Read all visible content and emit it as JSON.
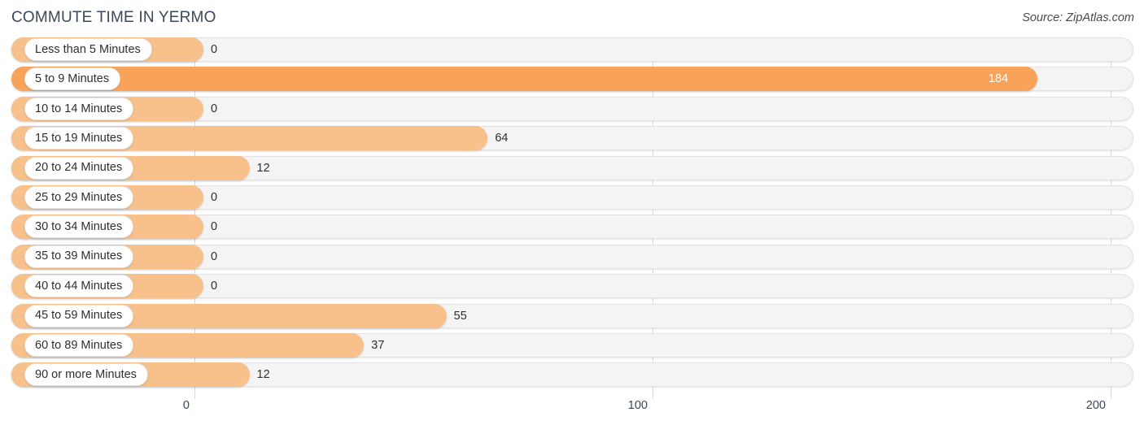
{
  "header": {
    "title": "COMMUTE TIME IN YERMO",
    "source": "Source: ZipAtlas.com"
  },
  "colors": {
    "bar": "#f8c08a",
    "bar_highlight": "#f9a35a",
    "track": "#f4f4f4",
    "gridline": "#d9d9d9",
    "text": "#2f2f2f",
    "title": "#3c4858"
  },
  "chart_data": {
    "type": "bar",
    "orientation": "horizontal",
    "title": "COMMUTE TIME IN YERMO",
    "subtitle": "",
    "xlabel": "",
    "ylabel": "",
    "xlim": [
      0,
      200
    ],
    "grid": true,
    "legend": null,
    "source": "Source: ZipAtlas.com",
    "xticks": [
      "0",
      "100",
      "200"
    ],
    "xtick_values": [
      0,
      100,
      200
    ],
    "categories": [
      "Less than 5 Minutes",
      "5 to 9 Minutes",
      "10 to 14 Minutes",
      "15 to 19 Minutes",
      "20 to 24 Minutes",
      "25 to 29 Minutes",
      "30 to 34 Minutes",
      "35 to 39 Minutes",
      "40 to 44 Minutes",
      "45 to 59 Minutes",
      "60 to 89 Minutes",
      "90 or more Minutes"
    ],
    "values": [
      0,
      184,
      0,
      64,
      12,
      0,
      0,
      0,
      0,
      55,
      37,
      12
    ],
    "value_labels": [
      "0",
      "184",
      "0",
      "64",
      "12",
      "0",
      "0",
      "0",
      "0",
      "55",
      "37",
      "12"
    ],
    "highlight_index": 1
  },
  "rows": [
    {
      "label": "Less than 5 Minutes",
      "value": 0,
      "value_label": "0",
      "highlight": false,
      "label_inside": false
    },
    {
      "label": "5 to 9 Minutes",
      "value": 184,
      "value_label": "184",
      "highlight": true,
      "label_inside": true
    },
    {
      "label": "10 to 14 Minutes",
      "value": 0,
      "value_label": "0",
      "highlight": false,
      "label_inside": false
    },
    {
      "label": "15 to 19 Minutes",
      "value": 64,
      "value_label": "64",
      "highlight": false,
      "label_inside": false
    },
    {
      "label": "20 to 24 Minutes",
      "value": 12,
      "value_label": "12",
      "highlight": false,
      "label_inside": false
    },
    {
      "label": "25 to 29 Minutes",
      "value": 0,
      "value_label": "0",
      "highlight": false,
      "label_inside": false
    },
    {
      "label": "30 to 34 Minutes",
      "value": 0,
      "value_label": "0",
      "highlight": false,
      "label_inside": false
    },
    {
      "label": "35 to 39 Minutes",
      "value": 0,
      "value_label": "0",
      "highlight": false,
      "label_inside": false
    },
    {
      "label": "40 to 44 Minutes",
      "value": 0,
      "value_label": "0",
      "highlight": false,
      "label_inside": false
    },
    {
      "label": "45 to 59 Minutes",
      "value": 55,
      "value_label": "55",
      "highlight": false,
      "label_inside": false
    },
    {
      "label": "60 to 89 Minutes",
      "value": 37,
      "value_label": "37",
      "highlight": false,
      "label_inside": false
    },
    {
      "label": "90 or more Minutes",
      "value": 12,
      "value_label": "12",
      "highlight": false,
      "label_inside": false
    }
  ],
  "axis": {
    "ticks": [
      {
        "label": "0",
        "value": 0
      },
      {
        "label": "100",
        "value": 100
      },
      {
        "label": "200",
        "value": 200
      }
    ]
  }
}
